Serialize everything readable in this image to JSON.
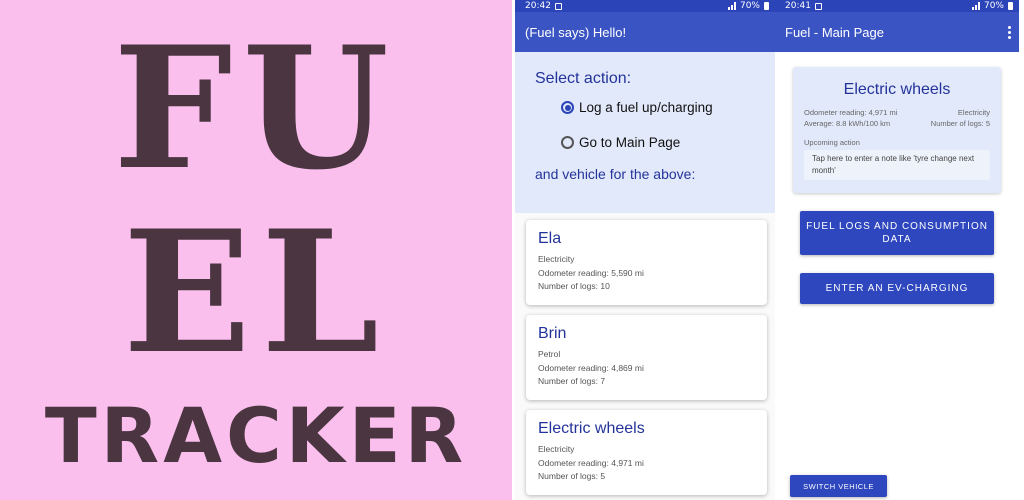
{
  "promo": {
    "logo_line1": "FU",
    "logo_line2": "EL",
    "logo_line3": "TRACKER"
  },
  "phone_left": {
    "status_time": "20:42",
    "status_battery": "70%",
    "app_title": "(Fuel says) Hello!",
    "select_action_label": "Select action:",
    "options": [
      {
        "label": "Log a fuel up/charging",
        "selected": true
      },
      {
        "label": "Go to Main Page",
        "selected": false
      }
    ],
    "vehicle_prompt": "and vehicle for the above:",
    "vehicles": [
      {
        "name": "Ela",
        "fuel": "Electricity",
        "odometer": "Odometer reading: 5,590 mi",
        "logs": "Number of logs: 10"
      },
      {
        "name": "Brin",
        "fuel": "Petrol",
        "odometer": "Odometer reading: 4,869 mi",
        "logs": "Number of logs: 7"
      },
      {
        "name": "Electric wheels",
        "fuel": "Electricity",
        "odometer": "Odometer reading: 4,971 mi",
        "logs": "Number of logs: 5"
      }
    ]
  },
  "phone_right": {
    "status_time": "20:41",
    "status_battery": "70%",
    "app_title": "Fuel - Main Page",
    "summary": {
      "vehicle_name": "Electric wheels",
      "odometer": "Odometer reading: 4,971 mi",
      "fuel_type": "Electricity",
      "average": "Average: 8.8 kWh/100 km",
      "logs": "Number of logs: 5",
      "upcoming_label": "Upcoming action",
      "note_placeholder": "Tap here to enter a note like 'tyre change next month'"
    },
    "btn_fuel_logs": "FUEL LOGS AND CONSUMPTION DATA",
    "btn_enter_ev": "ENTER AN EV-CHARGING",
    "btn_switch_vehicle": "SWITCH VEHICLE"
  },
  "colors": {
    "promo_bg": "#fbbfee",
    "logo_text": "#4a3540",
    "primary": "#3a54c4",
    "panel_bg": "#e2e9fb"
  }
}
